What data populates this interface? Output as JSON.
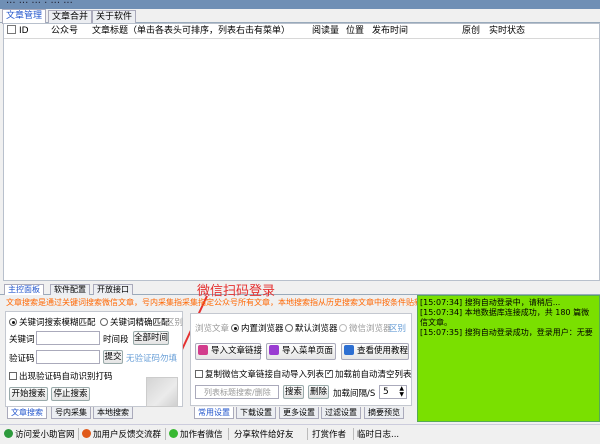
{
  "window": {
    "title": "...  ...  ...    .  ...  ..."
  },
  "top_tabs": [
    "文章管理",
    "文章合并",
    "关于软件"
  ],
  "table": {
    "columns": [
      "ID",
      "公众号",
      "文章标题（单击各表头可排序，列表右击有菜单）",
      "阅读量",
      "位置",
      "发布时间",
      "原创",
      "实时状态"
    ]
  },
  "bottom_tabs": [
    "主控面板",
    "软件配置",
    "开放接口"
  ],
  "annotation": "微信扫码登录",
  "notice": "文章搜索是通过关键词搜索微信文章，号内采集指采集指定公众号所有文章，本地搜索指从历史搜索文章中按条件贴新",
  "search_panel": {
    "mode_fuzzy": "关键词搜索模糊匹配",
    "mode_exact": "关键词精确匹配",
    "mode_extra": "区别",
    "keyword_label": "关键词",
    "time_label": "时间段",
    "all_time_button": "全部时间",
    "captcha_label": "验证码",
    "submit_button": "提交",
    "captcha_hint": "无验证码勿填",
    "auto_captcha": "出现验证码自动识别打码",
    "start_button": "开始搜索",
    "stop_button": "停止搜索",
    "tabs": [
      "文章搜索",
      "号内采集",
      "本地搜索"
    ]
  },
  "browser_panel": {
    "browse_label": "浏览文章",
    "builtin": "内置浏览器",
    "default": "默认浏览器",
    "wechat": "微信浏览器",
    "diff": "区别",
    "import_links": "导入文章链接",
    "import_menu": "导入菜单页面",
    "tutorial": "查看使用教程",
    "copy_import": "复制微信文章链接自动导入列表",
    "clear_before_load": "加载前自动清空列表",
    "search_placeholder": "列表标题搜索/删除",
    "search_button": "搜索",
    "delete_button": "删除",
    "interval_label": "加载间隔/S",
    "interval_value": "5",
    "tabs": [
      "常用设置",
      "下载设置",
      "更多设置",
      "过滤设置",
      "摘要预览"
    ]
  },
  "log": [
    "[15:07:34] 搜狗自动登录中，请稍后...",
    "[15:07:34] 本地数据库连接成功，共 180 篇微信文章。",
    "[15:07:35] 搜狗自动登录成功，登录用户：无要"
  ],
  "status_bar": [
    "访问爱小助官网",
    "加用户反馈交流群",
    "加作者微信",
    "分享软件给好友",
    "打赏作者",
    "临时日志..."
  ],
  "colors": {
    "accent": "#2255cc",
    "log_bg": "#7ae000",
    "notice": "#ff6600",
    "annotation": "#e53030"
  }
}
